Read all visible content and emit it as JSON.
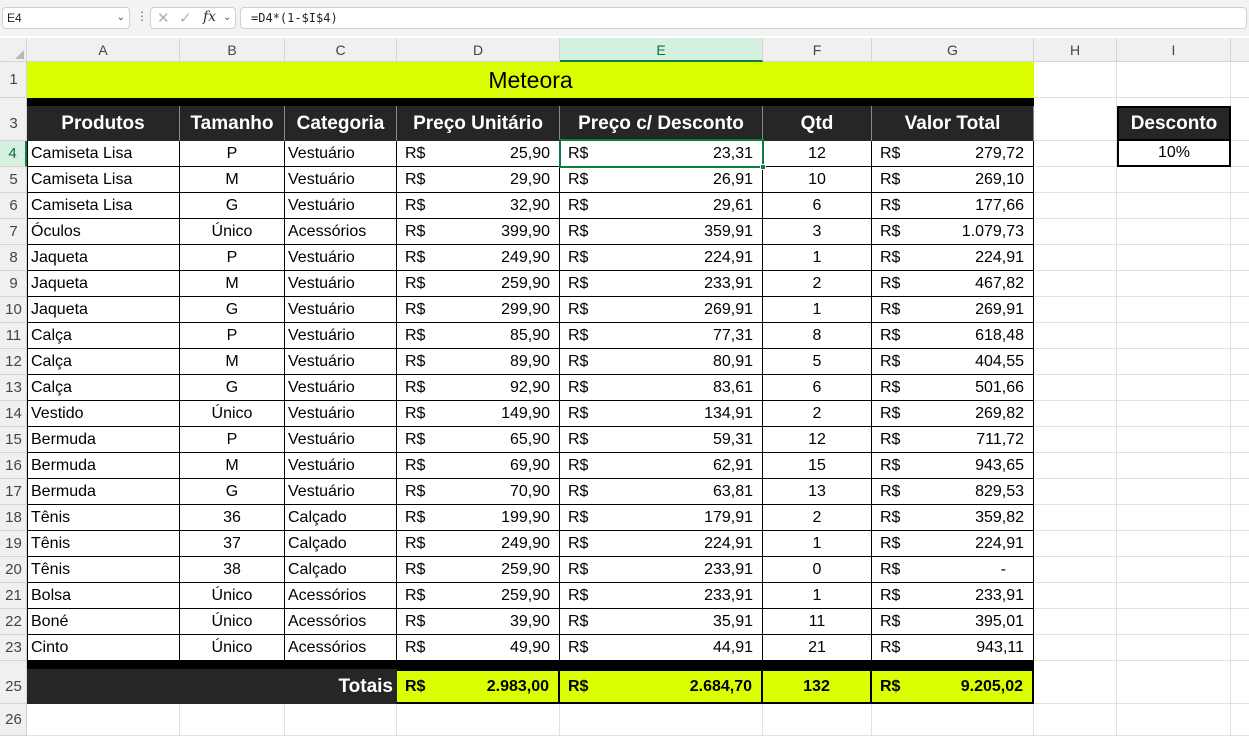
{
  "formula_bar": {
    "name_box": "E4",
    "formula": "=D4*(1-$I$4)",
    "fx_label": "fx"
  },
  "columns": [
    "A",
    "B",
    "C",
    "D",
    "E",
    "F",
    "G",
    "H",
    "I"
  ],
  "row_numbers": [
    "1",
    "3",
    "4",
    "5",
    "6",
    "7",
    "8",
    "9",
    "10",
    "11",
    "12",
    "13",
    "14",
    "15",
    "16",
    "17",
    "18",
    "19",
    "20",
    "21",
    "22",
    "23",
    "25",
    "26"
  ],
  "sheet": {
    "title": "Meteora",
    "headers": [
      "Produtos",
      "Tamanho",
      "Categoria",
      "Preço Unitário",
      "Preço c/ Desconto",
      "Qtd",
      "Valor Total"
    ],
    "currency": "R$",
    "rows": [
      {
        "produto": "Camiseta Lisa",
        "tamanho": "P",
        "categoria": "Vestuário",
        "preco": "25,90",
        "desconto": "23,31",
        "qtd": "12",
        "total": "279,72"
      },
      {
        "produto": "Camiseta Lisa",
        "tamanho": "M",
        "categoria": "Vestuário",
        "preco": "29,90",
        "desconto": "26,91",
        "qtd": "10",
        "total": "269,10"
      },
      {
        "produto": "Camiseta Lisa",
        "tamanho": "G",
        "categoria": "Vestuário",
        "preco": "32,90",
        "desconto": "29,61",
        "qtd": "6",
        "total": "177,66"
      },
      {
        "produto": "Óculos",
        "tamanho": "Único",
        "categoria": "Acessórios",
        "preco": "399,90",
        "desconto": "359,91",
        "qtd": "3",
        "total": "1.079,73"
      },
      {
        "produto": "Jaqueta",
        "tamanho": "P",
        "categoria": "Vestuário",
        "preco": "249,90",
        "desconto": "224,91",
        "qtd": "1",
        "total": "224,91"
      },
      {
        "produto": "Jaqueta",
        "tamanho": "M",
        "categoria": "Vestuário",
        "preco": "259,90",
        "desconto": "233,91",
        "qtd": "2",
        "total": "467,82"
      },
      {
        "produto": "Jaqueta",
        "tamanho": "G",
        "categoria": "Vestuário",
        "preco": "299,90",
        "desconto": "269,91",
        "qtd": "1",
        "total": "269,91"
      },
      {
        "produto": "Calça",
        "tamanho": "P",
        "categoria": "Vestuário",
        "preco": "85,90",
        "desconto": "77,31",
        "qtd": "8",
        "total": "618,48"
      },
      {
        "produto": "Calça",
        "tamanho": "M",
        "categoria": "Vestuário",
        "preco": "89,90",
        "desconto": "80,91",
        "qtd": "5",
        "total": "404,55"
      },
      {
        "produto": "Calça",
        "tamanho": "G",
        "categoria": "Vestuário",
        "preco": "92,90",
        "desconto": "83,61",
        "qtd": "6",
        "total": "501,66"
      },
      {
        "produto": "Vestido",
        "tamanho": "Único",
        "categoria": "Vestuário",
        "preco": "149,90",
        "desconto": "134,91",
        "qtd": "2",
        "total": "269,82"
      },
      {
        "produto": "Bermuda",
        "tamanho": "P",
        "categoria": "Vestuário",
        "preco": "65,90",
        "desconto": "59,31",
        "qtd": "12",
        "total": "711,72"
      },
      {
        "produto": "Bermuda",
        "tamanho": "M",
        "categoria": "Vestuário",
        "preco": "69,90",
        "desconto": "62,91",
        "qtd": "15",
        "total": "943,65"
      },
      {
        "produto": "Bermuda",
        "tamanho": "G",
        "categoria": "Vestuário",
        "preco": "70,90",
        "desconto": "63,81",
        "qtd": "13",
        "total": "829,53"
      },
      {
        "produto": "Tênis",
        "tamanho": "36",
        "categoria": "Calçado",
        "preco": "199,90",
        "desconto": "179,91",
        "qtd": "2",
        "total": "359,82"
      },
      {
        "produto": "Tênis",
        "tamanho": "37",
        "categoria": "Calçado",
        "preco": "249,90",
        "desconto": "224,91",
        "qtd": "1",
        "total": "224,91"
      },
      {
        "produto": "Tênis",
        "tamanho": "38",
        "categoria": "Calçado",
        "preco": "259,90",
        "desconto": "233,91",
        "qtd": "0",
        "total": "-"
      },
      {
        "produto": "Bolsa",
        "tamanho": "Único",
        "categoria": "Acessórios",
        "preco": "259,90",
        "desconto": "233,91",
        "qtd": "1",
        "total": "233,91"
      },
      {
        "produto": "Boné",
        "tamanho": "Único",
        "categoria": "Acessórios",
        "preco": "39,90",
        "desconto": "35,91",
        "qtd": "11",
        "total": "395,01"
      },
      {
        "produto": "Cinto",
        "tamanho": "Único",
        "categoria": "Acessórios",
        "preco": "49,90",
        "desconto": "44,91",
        "qtd": "21",
        "total": "943,11"
      }
    ],
    "totals": {
      "label": "Totais",
      "preco": "2.983,00",
      "desconto": "2.684,70",
      "qtd": "132",
      "total": "9.205,02"
    },
    "discount": {
      "label": "Desconto",
      "value": "10%"
    }
  },
  "colors": {
    "accent_yellow": "#dbff00",
    "header_dark": "#262626",
    "selection_green": "#107c41"
  }
}
